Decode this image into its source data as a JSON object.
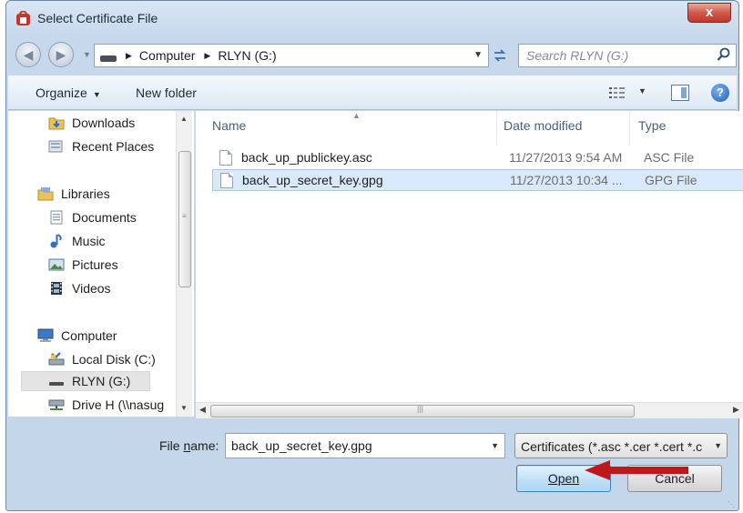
{
  "window": {
    "title": "Select Certificate File",
    "close_label": "x"
  },
  "address": {
    "crumbs": [
      "Computer",
      "RLYN (G:)"
    ],
    "search_placeholder": "Search RLYN (G:)"
  },
  "toolbar": {
    "organize_label": "Organize",
    "new_folder_label": "New folder"
  },
  "nav": {
    "items": [
      {
        "label": "Downloads",
        "icon": "downloads-folder-icon"
      },
      {
        "label": "Recent Places",
        "icon": "recent-places-icon"
      },
      {
        "label": "Libraries",
        "icon": "libraries-icon"
      },
      {
        "label": "Documents",
        "icon": "documents-icon"
      },
      {
        "label": "Music",
        "icon": "music-icon"
      },
      {
        "label": "Pictures",
        "icon": "pictures-icon"
      },
      {
        "label": "Videos",
        "icon": "videos-icon"
      },
      {
        "label": "Computer",
        "icon": "computer-icon"
      },
      {
        "label": "Local Disk (C:)",
        "icon": "local-disk-icon"
      },
      {
        "label": "RLYN (G:)",
        "icon": "usb-drive-icon",
        "selected": true
      },
      {
        "label": "Drive H (\\\\nasug",
        "icon": "network-drive-icon"
      }
    ]
  },
  "files": {
    "columns": {
      "name": "Name",
      "date": "Date modified",
      "type": "Type"
    },
    "rows": [
      {
        "name": "back_up_publickey.asc",
        "date": "11/27/2013 9:54 AM",
        "type": "ASC File",
        "selected": false
      },
      {
        "name": "back_up_secret_key.gpg",
        "date": "11/27/2013 10:34 ...",
        "type": "GPG File",
        "selected": true
      }
    ]
  },
  "bottom": {
    "file_name_label_prefix": "File ",
    "file_name_label_accel": "n",
    "file_name_label_suffix": "ame:",
    "file_name_value": "back_up_secret_key.gpg",
    "filter_value": "Certificates (*.asc *.cer *.cert *.c",
    "open_label": "Open",
    "cancel_label": "Cancel"
  },
  "colors": {
    "annotation_arrow": "#c0171c",
    "selection": "#d9e8fb"
  }
}
